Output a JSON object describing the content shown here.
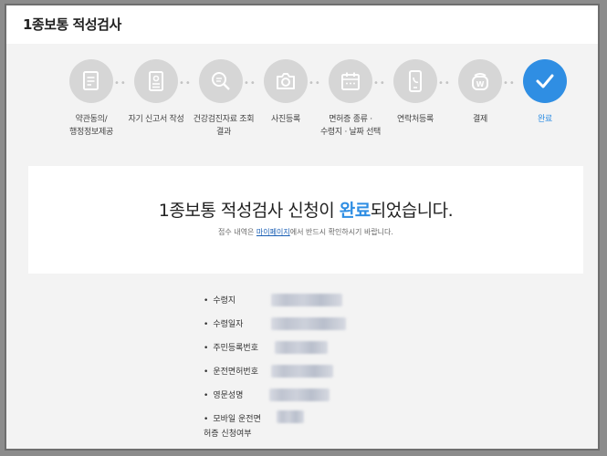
{
  "header": {
    "title": "1종보통 적성검사"
  },
  "steps": [
    {
      "icon": "document-icon",
      "label_line1": "약관동의/",
      "label_line2": "행정정보제공"
    },
    {
      "icon": "form-icon",
      "label_line1": "자기 신고서 작성",
      "label_line2": ""
    },
    {
      "icon": "search-icon",
      "label_line1": "건강검진자료 조회",
      "label_line2": "결과"
    },
    {
      "icon": "camera-icon",
      "label_line1": "사진등록",
      "label_line2": ""
    },
    {
      "icon": "calendar-icon",
      "label_line1": "면허증 종류 ·",
      "label_line2": "수령지 · 날짜 선택"
    },
    {
      "icon": "phone-icon",
      "label_line1": "연락처등록",
      "label_line2": ""
    },
    {
      "icon": "wallet-icon",
      "label_line1": "결제",
      "label_line2": ""
    },
    {
      "icon": "check-icon",
      "label_line1": "완료",
      "label_line2": ""
    }
  ],
  "completion": {
    "title_before": "1종보통 적성검사 신청이 ",
    "title_highlight": "완료",
    "title_after": "되었습니다.",
    "sub_before": "접수 내역은 ",
    "sub_link": "마이페이지",
    "sub_after": "에서 반드시 확인하시기 바랍니다."
  },
  "details": [
    {
      "label": "수령지"
    },
    {
      "label": "수령일자"
    },
    {
      "label": "주민등록번호"
    },
    {
      "label": "운전면허번호"
    },
    {
      "label": "영문성명"
    },
    {
      "label_line1": "모바일 운전면",
      "label_line2": "허증 신청여부"
    }
  ],
  "colors": {
    "accent": "#2f8ee3",
    "inactive_circle": "#d6d6d6",
    "link": "#1a5fb4"
  }
}
